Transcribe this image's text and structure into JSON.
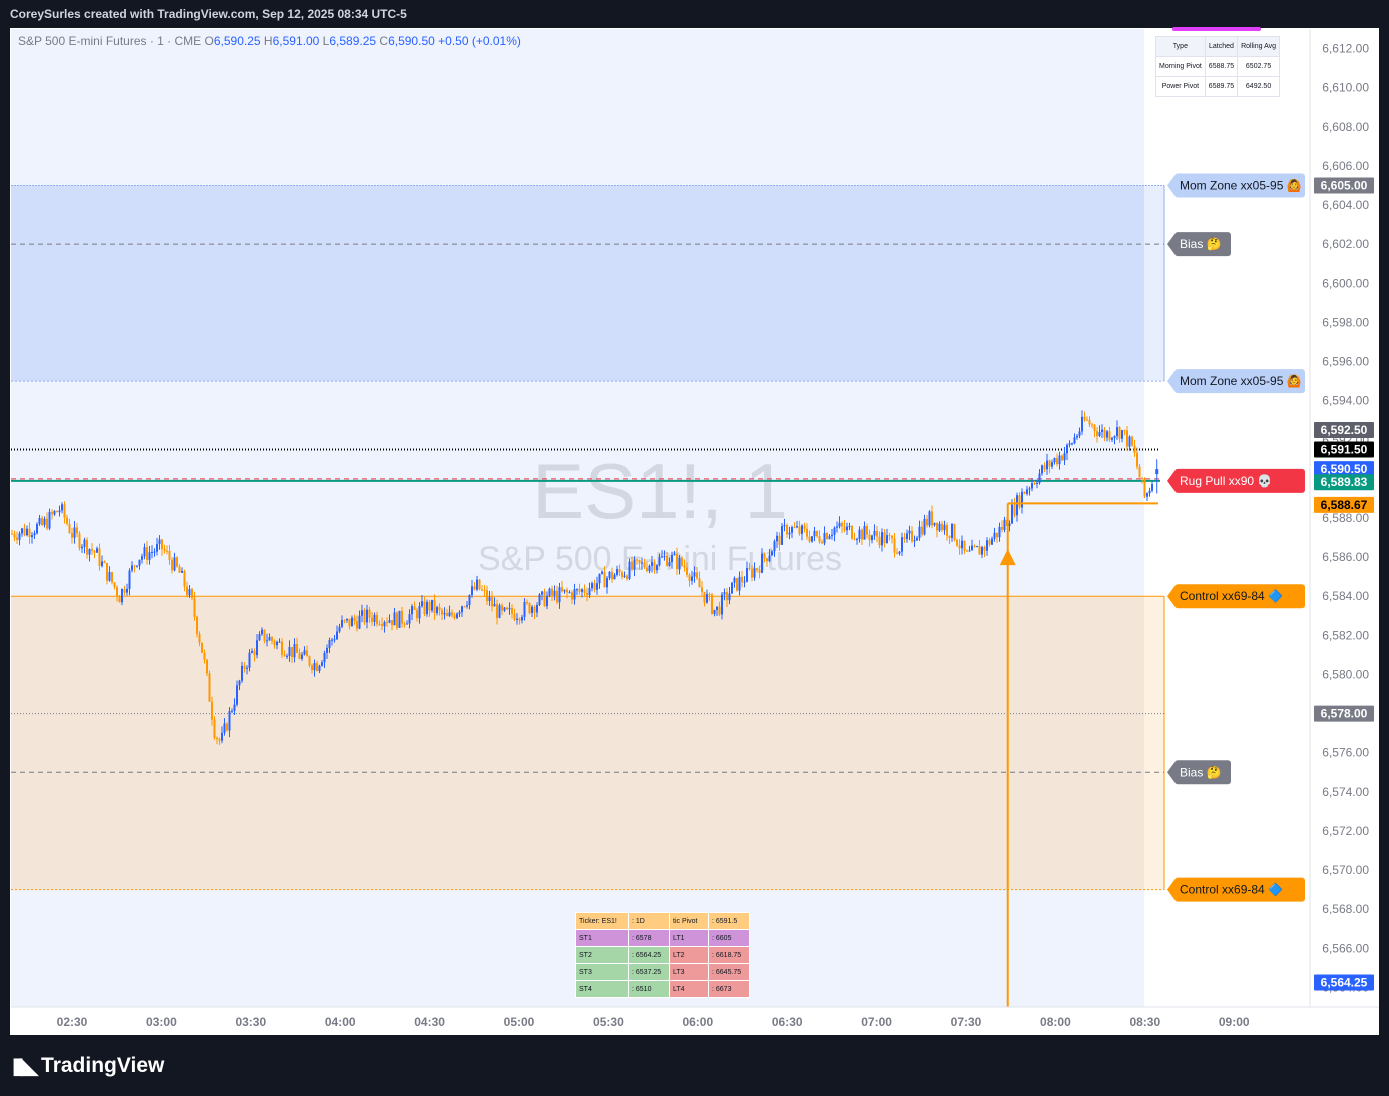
{
  "attribution": "CoreySurles created with TradingView.com, Sep 12, 2025 08:34 UTC-5",
  "brand": "TradingView",
  "legend": {
    "symbol": "S&P 500 E-mini Futures · 1 · CME",
    "o_key": "O",
    "o": "6,590.25",
    "h_key": "H",
    "h": "6,591.00",
    "l_key": "L",
    "l": "6,589.25",
    "c_key": "C",
    "c": "6,590.50",
    "chg": "+0.50 (+0.01%)"
  },
  "watermark": {
    "ticker": "ES1!, 1",
    "name": "S&P 500 E-mini Futures"
  },
  "colors": {
    "up": "#2962ff",
    "down": "#ff9800",
    "mom_zone": "#d1defb",
    "control_zone": "#f3e5d8",
    "chart_bg": "#eef3fe"
  },
  "pivot_table": {
    "headers": [
      "Type",
      "Latched",
      "Rolling Avg"
    ],
    "rows": [
      [
        "Morning Pivot",
        "6588.75",
        "6502.75"
      ],
      [
        "Power Pivot",
        "6589.75",
        "6492.50"
      ]
    ]
  },
  "levels_table": {
    "rows": [
      [
        "Ticker: ES1!",
        ": 1D",
        "tic Pivot",
        ": 6591.5"
      ],
      [
        "ST1",
        ": 6578",
        "LT1",
        ": 6605"
      ],
      [
        "ST2",
        ": 6564.25",
        "LT2",
        ": 6618.75"
      ],
      [
        "ST3",
        ": 6537.25",
        "LT3",
        ": 6645.75"
      ],
      [
        "ST4",
        ": 6510",
        "LT4",
        ": 6673"
      ]
    ]
  },
  "chart_data": {
    "type": "candlestick",
    "title": "S&P 500 E-mini Futures · 1 · CME",
    "x_ticks": [
      "02:30",
      "03:00",
      "03:30",
      "04:00",
      "04:30",
      "05:00",
      "05:30",
      "06:00",
      "06:30",
      "07:00",
      "07:30",
      "08:00",
      "08:30",
      "09:00"
    ],
    "y_ticks": [
      "6,612.00",
      "6,610.00",
      "6,608.00",
      "6,606.00",
      "6,604.00",
      "6,602.00",
      "6,600.00",
      "6,598.00",
      "6,596.00",
      "6,594.00",
      "6,592.00",
      "6,590.00",
      "6,588.00",
      "6,586.00",
      "6,584.00",
      "6,582.00",
      "6,580.00",
      "6,578.00",
      "6,576.00",
      "6,574.00",
      "6,572.00",
      "6,570.00",
      "6,568.00",
      "6,566.00",
      "6,564.00"
    ],
    "ylim": [
      6563,
      6613
    ],
    "time_range": [
      "02:10",
      "08:34"
    ],
    "close_path": [
      [
        "02:10",
        6587.2
      ],
      [
        "02:20",
        6587.6
      ],
      [
        "02:26",
        6588.5
      ],
      [
        "02:30",
        6587.2
      ],
      [
        "02:38",
        6586.2
      ],
      [
        "02:46",
        6584.0
      ],
      [
        "02:52",
        6586.0
      ],
      [
        "03:00",
        6586.5
      ],
      [
        "03:06",
        6585.2
      ],
      [
        "03:10",
        6583.8
      ],
      [
        "03:14",
        6581.0
      ],
      [
        "03:18",
        6577.0
      ],
      [
        "03:20",
        6576.5
      ],
      [
        "03:24",
        6578.5
      ],
      [
        "03:28",
        6580.5
      ],
      [
        "03:34",
        6582.0
      ],
      [
        "03:40",
        6581.5
      ],
      [
        "03:46",
        6581.0
      ],
      [
        "03:52",
        6580.5
      ],
      [
        "04:00",
        6582.5
      ],
      [
        "04:10",
        6583.0
      ],
      [
        "04:20",
        6582.8
      ],
      [
        "04:30",
        6583.5
      ],
      [
        "04:36",
        6582.8
      ],
      [
        "04:46",
        6584.5
      ],
      [
        "04:54",
        6583.0
      ],
      [
        "05:00",
        6583.2
      ],
      [
        "05:10",
        6584.0
      ],
      [
        "05:20",
        6584.2
      ],
      [
        "05:30",
        6585.0
      ],
      [
        "05:40",
        6585.5
      ],
      [
        "05:50",
        6586.0
      ],
      [
        "05:56",
        6585.5
      ],
      [
        "06:06",
        6583.2
      ],
      [
        "06:12",
        6584.5
      ],
      [
        "06:20",
        6585.5
      ],
      [
        "06:30",
        6587.5
      ],
      [
        "06:40",
        6587.0
      ],
      [
        "06:46",
        6587.5
      ],
      [
        "06:56",
        6587.2
      ],
      [
        "07:02",
        6587.0
      ],
      [
        "07:08",
        6586.5
      ],
      [
        "07:18",
        6588.0
      ],
      [
        "07:26",
        6587.2
      ],
      [
        "07:30",
        6586.0
      ],
      [
        "07:36",
        6586.5
      ],
      [
        "07:42",
        6587.5
      ],
      [
        "07:50",
        6589.5
      ],
      [
        "07:56",
        6590.5
      ],
      [
        "08:04",
        6591.5
      ],
      [
        "08:10",
        6593.0
      ],
      [
        "08:16",
        6592.3
      ],
      [
        "08:22",
        6592.5
      ],
      [
        "08:26",
        6591.5
      ],
      [
        "08:30",
        6589.0
      ],
      [
        "08:34",
        6590.5
      ]
    ],
    "candles": [
      {
        "name": "current",
        "time": "08:34",
        "open": 6590.25,
        "high": 6591.0,
        "low": 6589.25,
        "close": 6590.5
      }
    ],
    "price_labels": [
      {
        "text": "6,605.00",
        "value": 6605.0,
        "bg": "#787b86",
        "fg": "#ffffff"
      },
      {
        "text": "6,592.50",
        "value": 6592.5,
        "bg": "#5d606b",
        "fg": "#ffffff"
      },
      {
        "text": "6,591.50",
        "value": 6591.5,
        "bg": "#000000",
        "fg": "#ffffff"
      },
      {
        "text": "6,590.50",
        "value": 6590.5,
        "bg": "#2962ff",
        "fg": "#ffffff",
        "sub": "00:17"
      },
      {
        "text": "6,589.83",
        "value": 6589.83,
        "bg": "#089981",
        "fg": "#ffffff"
      },
      {
        "text": "6,588.67",
        "value": 6588.67,
        "bg": "#ff9800",
        "fg": "#000000"
      },
      {
        "text": "6,578.00",
        "value": 6578.0,
        "bg": "#787b86",
        "fg": "#ffffff"
      },
      {
        "text": "6,564.25",
        "value": 6564.25,
        "bg": "#2962ff",
        "fg": "#ffffff"
      }
    ],
    "zone_labels": [
      {
        "text": "Mom Zone xx05-95 🙆",
        "value": 6605.0,
        "bg": "#bbd1f8",
        "fg": "#131722"
      },
      {
        "text": "Bias 🤔",
        "value": 6602.0,
        "bg": "#787b86",
        "fg": "#ffffff"
      },
      {
        "text": "Mom Zone xx05-95 🙆",
        "value": 6595.0,
        "bg": "#bbd1f8",
        "fg": "#131722"
      },
      {
        "text": "Rug Pull xx90 💀",
        "value": 6589.9,
        "bg": "#f23645",
        "fg": "#ffffff"
      },
      {
        "text": "Control xx69-84 🔷",
        "value": 6584.0,
        "bg": "#ff9800",
        "fg": "#131722"
      },
      {
        "text": "Bias 🤔",
        "value": 6575.0,
        "bg": "#787b86",
        "fg": "#ffffff"
      },
      {
        "text": "Control xx69-84 🔷",
        "value": 6569.0,
        "bg": "#ff9800",
        "fg": "#131722"
      }
    ],
    "zones": [
      {
        "name": "mom-zone",
        "from": 6595.0,
        "to": 6605.0,
        "color": "#d1defb"
      },
      {
        "name": "control-zone",
        "from": 6569.0,
        "to": 6584.0,
        "color": "#f3e5d8"
      }
    ],
    "lines": [
      {
        "name": "pivot-black",
        "value": 6591.5,
        "color": "#000000",
        "style": "dotted"
      },
      {
        "name": "rug-pull-green",
        "value": 6589.9,
        "color": "#089981",
        "style": "solid"
      },
      {
        "name": "rug-pull-red-dash",
        "value": 6590.0,
        "color": "#f23645",
        "style": "dashed"
      },
      {
        "name": "bias-upper",
        "value": 6602.0,
        "color": "#787b86",
        "style": "dashed"
      },
      {
        "name": "bias-lower",
        "value": 6575.0,
        "color": "#787b86",
        "style": "dashed"
      },
      {
        "name": "st1-level",
        "value": 6578.0,
        "color": "#787b86",
        "style": "dotted"
      }
    ],
    "marker": {
      "time": "07:44",
      "value": 6588.75
    }
  }
}
